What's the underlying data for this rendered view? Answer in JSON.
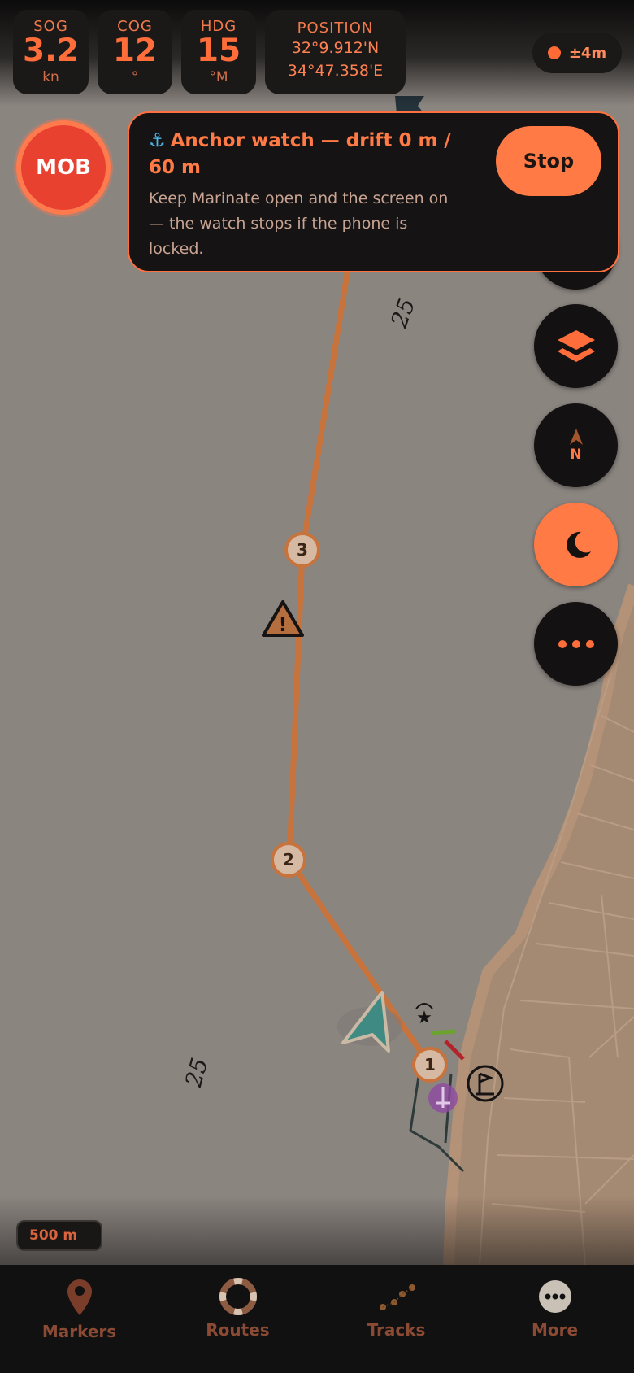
{
  "instruments": {
    "sog": {
      "label": "SOG",
      "value": "3.2",
      "unit": "kn"
    },
    "cog": {
      "label": "COG",
      "value": "12",
      "unit": "°"
    },
    "hdg": {
      "label": "HDG",
      "value": "15",
      "unit": "°M"
    },
    "position": {
      "label": "POSITION",
      "lat": "32°9.912'N",
      "lon": "34°47.358'E"
    }
  },
  "gps_accuracy": "±4m",
  "mob_label": "MOB",
  "anchor_watch": {
    "title": "Anchor watch — drift 0 m / 60 m",
    "description": "Keep Marinate open and the screen on — the watch stops if the phone is locked.",
    "stop_label": "Stop"
  },
  "map": {
    "depth_labels": [
      "25",
      "25"
    ],
    "waypoints": [
      "1",
      "2",
      "3"
    ],
    "scale_label": "500 m"
  },
  "fabs": {
    "compass_label": "N"
  },
  "nav": {
    "items": [
      {
        "label": "Markers",
        "icon": "marker-pin-icon"
      },
      {
        "label": "Routes",
        "icon": "lifebuoy-icon"
      },
      {
        "label": "Tracks",
        "icon": "tracks-icon"
      },
      {
        "label": "More",
        "icon": "more-icon"
      }
    ]
  },
  "colors": {
    "accent": "#ff7a45",
    "route": "#c8733c",
    "vessel": "#3f8a82",
    "background": "#121111"
  }
}
